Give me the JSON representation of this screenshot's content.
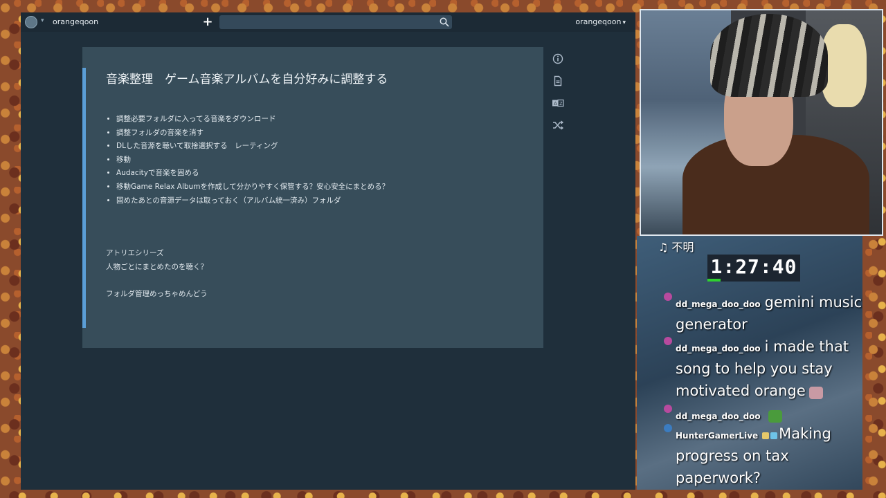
{
  "app": {
    "user_name": "orangeqoon",
    "search_value": "",
    "account_menu_label": "orangeqoon"
  },
  "note": {
    "title": "音楽整理　ゲーム音楽アルバムを自分好みに調整する",
    "bullets": [
      "調整必要フォルダに入ってる音楽をダウンロード",
      "調整フォルダの音楽を消す",
      "DLした音源を聴いて取捨選択する　レーティング",
      "移動",
      "Audacityで音楽を固める",
      "移動Game Relax Albumを作成して分かりやすく保管する？安心安全にまとめる？",
      "固めたあとの音源データは取っておく（アルバム統一済み）フォルダ"
    ],
    "paragraph_1_line_1": "アトリエシリーズ",
    "paragraph_1_line_2": "人物ごとにまとめたのを聴く？",
    "paragraph_2": "フォルダ管理めっちゃめんどう"
  },
  "tools": {
    "icons": [
      "info-icon",
      "document-icon",
      "translate-icon",
      "shuffle-icon"
    ]
  },
  "stream": {
    "now_playing_label": "♫ 不明",
    "timer": "1:27:40",
    "timer_progress_fraction": 0.14,
    "chat": [
      {
        "user": "dd_mega_doo_doo",
        "text": "gemini music generator"
      },
      {
        "user": "dd_mega_doo_doo",
        "text": "i made that song to help you stay motivated orange"
      },
      {
        "user": "dd_mega_doo_doo",
        "text": ""
      },
      {
        "user": "HunterGamerLive",
        "text": "Making progress on tax paperwork?"
      }
    ]
  },
  "colors": {
    "app_bg": "#1f2f3b",
    "card_bg": "#374d5a",
    "accent": "#5b9ed6",
    "timer_progress": "#2fd12f"
  }
}
